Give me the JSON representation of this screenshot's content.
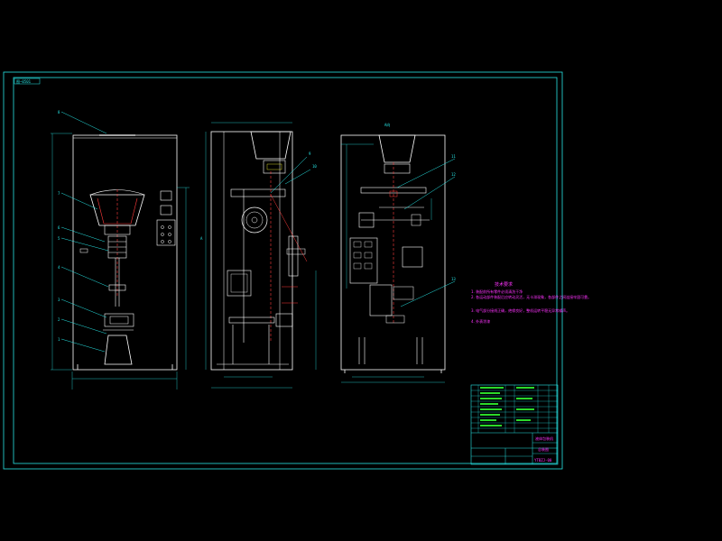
{
  "drawing": {
    "tag_top_left": "图—0501",
    "view_label_center": "A",
    "view_label_right": "A向",
    "part_labels_front": [
      "8",
      "7",
      "6",
      "5",
      "4",
      "3",
      "2",
      "1"
    ],
    "part_labels_side": [
      "9",
      "10"
    ],
    "part_labels_rear": [
      "11",
      "12",
      "13"
    ],
    "tech_notes_title": "技术要求",
    "tech_notes": [
      "1. 装配前所有零件必须清洗干净",
      "2. 各运动部件装配后应转动灵活，无卡滞现象，各部件之间连接牢固可靠。",
      "3. 电气部分接线正确，绝缘良好，整机运转平稳无异常噪声。",
      "4. 外表涂漆"
    ],
    "title_block": {
      "name": "液体包装机",
      "drawing_title": "总装图",
      "code": "YTBZJ-00"
    },
    "colors": {
      "frame": "#27e6e6",
      "outline": "#ffffff",
      "leader": "#27e6e6",
      "red": "#ff3b3b",
      "magenta": "#ff33ff",
      "green": "#33ff33",
      "yellow": "#ffff33"
    }
  }
}
